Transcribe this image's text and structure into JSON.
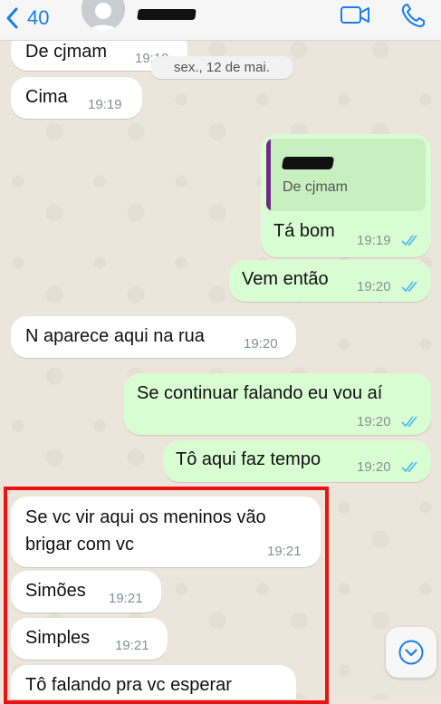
{
  "header": {
    "back_count": "40",
    "contact_name": "",
    "icons": [
      "chevron-left-icon",
      "avatar",
      "video-call-icon",
      "phone-icon"
    ]
  },
  "date_divider": "sex., 12 de mai.",
  "messages": [
    {
      "dir": "in",
      "text": "De cjmam",
      "time": "19:19"
    },
    {
      "dir": "in",
      "text": "Cima",
      "time": "19:19"
    },
    {
      "dir": "out",
      "quote": "De cjmam",
      "text": "Tá bom",
      "time": "19:19"
    },
    {
      "dir": "out",
      "text": "Vem então",
      "time": "19:20"
    },
    {
      "dir": "in",
      "text": "N aparece aqui na rua",
      "time": "19:20"
    },
    {
      "dir": "out",
      "text": "Se continuar falando eu vou aí",
      "time": "19:20"
    },
    {
      "dir": "out",
      "text": "Tô aqui faz tempo",
      "time": "19:20"
    },
    {
      "dir": "in",
      "text_line1": "Se vc vir aqui os meninos vão",
      "text_line2": "brigar com vc",
      "time": "19:21"
    },
    {
      "dir": "in",
      "text": "Simões",
      "time": "19:21"
    },
    {
      "dir": "in",
      "text": "Simples",
      "time": "19:21"
    },
    {
      "dir": "in",
      "text": "Tô falando pra vc esperar",
      "time": ""
    }
  ],
  "colors": {
    "accent": "#1a7cf2",
    "outgoing": "#d9fdd3",
    "incoming": "#ffffff",
    "highlight": "#ee1111",
    "read_ticks": "#53bdeb"
  }
}
